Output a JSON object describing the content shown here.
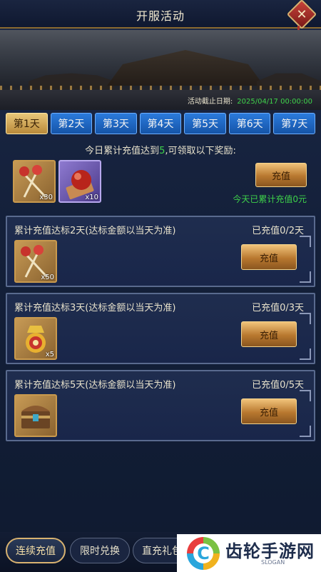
{
  "header": {
    "title": "开服活动"
  },
  "banner": {
    "deadline_label": "活动截止日期:",
    "deadline_date": "2025/04/17 00:00:00"
  },
  "tabs": [
    {
      "label": "第1天",
      "active": true
    },
    {
      "label": "第2天",
      "active": false
    },
    {
      "label": "第3天",
      "active": false
    },
    {
      "label": "第4天",
      "active": false
    },
    {
      "label": "第5天",
      "active": false
    },
    {
      "label": "第6天",
      "active": false
    },
    {
      "label": "第7天",
      "active": false
    }
  ],
  "day": {
    "target_prefix": "今日累计充值达到",
    "target_amount": "5",
    "target_suffix": ",可领取以下奖励:",
    "rewards": [
      {
        "icon": "candy-sticks-icon",
        "qty": "x30"
      },
      {
        "icon": "red-orb-icon",
        "qty": "x10"
      }
    ],
    "charge_label": "充值",
    "status": "今天已累计充值0元"
  },
  "cards": [
    {
      "title": "累计充值达标2天(达标金额以当天为准)",
      "progress": "已充值0/2天",
      "reward_icon": "candy-sticks-icon",
      "qty": "x50",
      "button": "充值"
    },
    {
      "title": "累计充值达标3天(达标金额以当天为准)",
      "progress": "已充值0/3天",
      "reward_icon": "golden-medal-icon",
      "qty": "x5",
      "button": "充值"
    },
    {
      "title": "累计充值达标5天(达标金额以当天为准)",
      "progress": "已充值0/5天",
      "reward_icon": "treasure-chest-icon",
      "qty": "",
      "button": "充值"
    }
  ],
  "bottom_nav": [
    {
      "label": "连续充值",
      "active": true
    },
    {
      "label": "限时兑换",
      "active": false
    },
    {
      "label": "直充礼包",
      "active": false
    }
  ],
  "watermark": {
    "text": "齿轮手游网",
    "slogan": "SLOGAN"
  },
  "colors": {
    "accent_gold": "#c99a4e",
    "highlight_green": "#3ed24a",
    "tab_blue": "#1e66c2"
  }
}
